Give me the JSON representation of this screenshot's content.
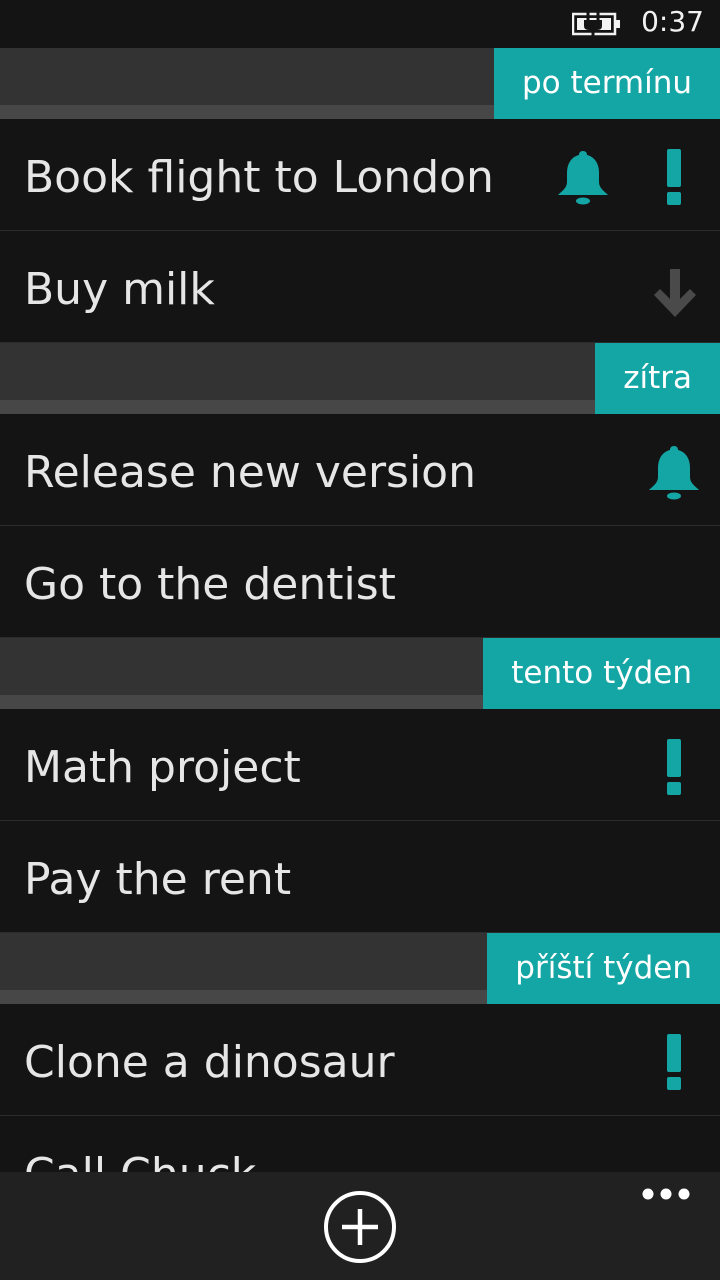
{
  "status_bar": {
    "time": "0:37",
    "icon": "battery-charging-icon"
  },
  "colors": {
    "accent": "#14a6a4",
    "background": "#141414",
    "header_bar": "#333333",
    "app_bar": "#212121"
  },
  "groups": [
    {
      "label": "po termínu",
      "tasks": [
        {
          "title": "Book flight to London",
          "icons": [
            "bell-icon",
            "exclamation-icon"
          ]
        },
        {
          "title": "Buy milk",
          "icons": [
            "arrow-down-icon"
          ]
        }
      ]
    },
    {
      "label": "zítra",
      "tasks": [
        {
          "title": "Release new version",
          "icons": [
            "bell-icon"
          ]
        },
        {
          "title": "Go to the dentist",
          "icons": []
        }
      ]
    },
    {
      "label": "tento týden",
      "tasks": [
        {
          "title": "Math project",
          "icons": [
            "exclamation-icon"
          ]
        },
        {
          "title": "Pay the rent",
          "icons": []
        }
      ]
    },
    {
      "label": "příští týden",
      "tasks": [
        {
          "title": "Clone a dinosaur",
          "icons": [
            "exclamation-icon"
          ]
        },
        {
          "title": "Call Chuck",
          "icons": []
        }
      ]
    }
  ],
  "app_bar": {
    "primary_icon": "add-circle-icon",
    "more_icon": "more-dots-icon"
  }
}
